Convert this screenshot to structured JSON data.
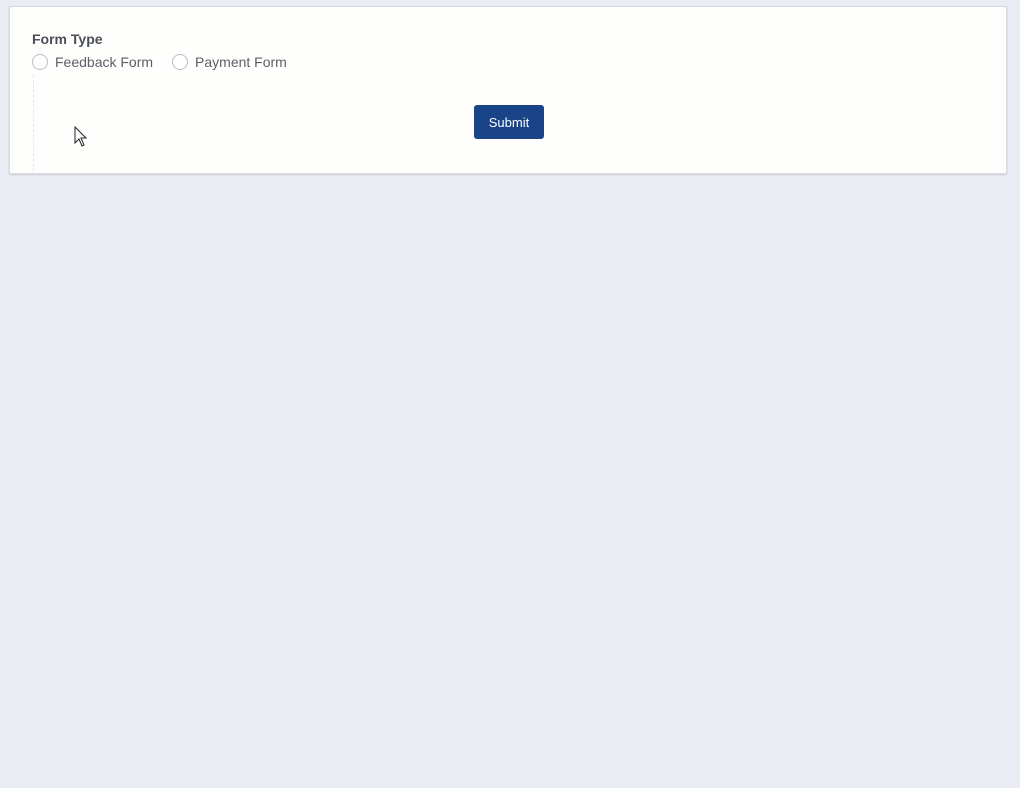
{
  "form": {
    "label": "Form Type",
    "options": [
      {
        "label": "Feedback Form",
        "selected": false
      },
      {
        "label": "Payment Form",
        "selected": false
      }
    ],
    "submit_label": "Submit"
  },
  "colors": {
    "background": "#e9ecf3",
    "card": "#fefefd",
    "primary_button": "#1a4488"
  },
  "icons": {
    "cursor": "mouse-pointer-icon"
  }
}
